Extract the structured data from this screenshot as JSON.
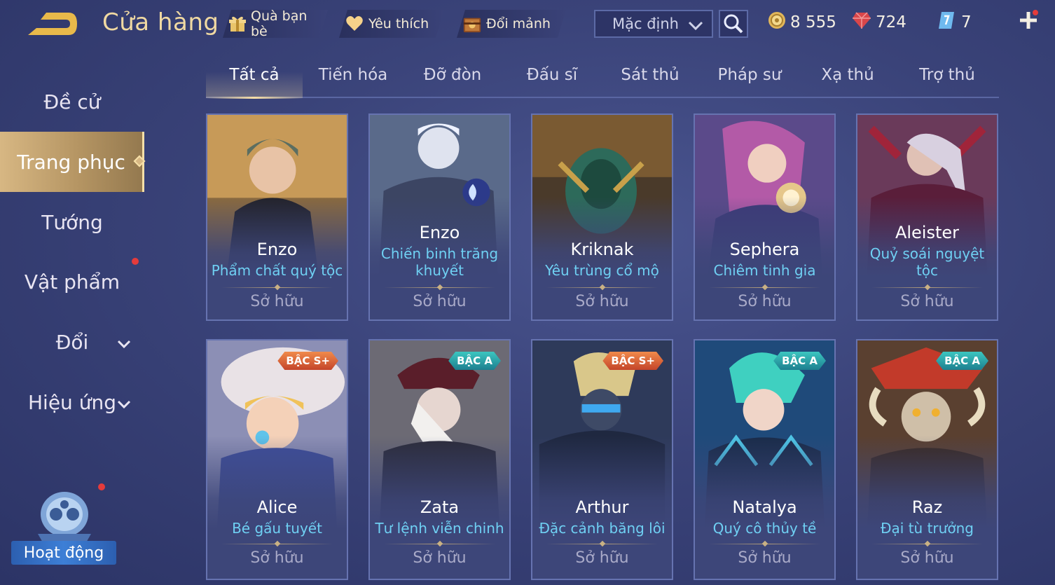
{
  "header": {
    "title": "Cửa hàng",
    "buttons": [
      {
        "label": "Quà bạn bè",
        "icon": "gift-icon"
      },
      {
        "label": "Yêu thích",
        "icon": "heart-icon"
      },
      {
        "label": "Đổi mảnh",
        "icon": "chest-icon"
      }
    ],
    "sort": {
      "value": "Mặc định"
    },
    "currencies": [
      {
        "value": "8 555",
        "icon": "gold-coin-icon"
      },
      {
        "value": "724",
        "icon": "red-gem-icon"
      },
      {
        "value": "7",
        "icon": "voucher-icon"
      }
    ]
  },
  "sidebar": {
    "items": [
      {
        "label": "Đề cử"
      },
      {
        "label": "Trang phục",
        "active": true
      },
      {
        "label": "Tướng"
      },
      {
        "label": "Vật phẩm"
      },
      {
        "label": "Đổi"
      },
      {
        "label": "Hiệu ứng"
      }
    ],
    "event_label": "Hoạt động"
  },
  "tabs": [
    "Tất cả",
    "Tiến hóa",
    "Đỡ đòn",
    "Đấu sĩ",
    "Sát thủ",
    "Pháp sư",
    "Xạ thủ",
    "Trợ thủ"
  ],
  "cards": [
    {
      "hero": "Enzo",
      "skin": "Phẩm chất quý tộc",
      "status": "Sở hữu",
      "badge": ""
    },
    {
      "hero": "Enzo",
      "skin": "Chiến binh trăng khuyết",
      "status": "Sở hữu",
      "badge": ""
    },
    {
      "hero": "Kriknak",
      "skin": "Yêu trùng cổ mộ",
      "status": "Sở hữu",
      "badge": ""
    },
    {
      "hero": "Sephera",
      "skin": "Chiêm tinh gia",
      "status": "Sở hữu",
      "badge": ""
    },
    {
      "hero": "Aleister",
      "skin": "Quỷ soái nguyệt tộc",
      "status": "Sở hữu",
      "badge": ""
    },
    {
      "hero": "Alice",
      "skin": "Bé gấu tuyết",
      "status": "Sở hữu",
      "badge": "BẬC S+"
    },
    {
      "hero": "Zata",
      "skin": "Tư lệnh viễn chinh",
      "status": "Sở hữu",
      "badge": "BẬC A"
    },
    {
      "hero": "Arthur",
      "skin": "Đặc cảnh băng lôi",
      "status": "Sở hữu",
      "badge": "BẬC S+"
    },
    {
      "hero": "Natalya",
      "skin": "Quý cô thủy tề",
      "status": "Sở hữu",
      "badge": "BẬC A"
    },
    {
      "hero": "Raz",
      "skin": "Đại tù trưởng",
      "status": "Sở hữu",
      "badge": "BẬC A"
    }
  ]
}
